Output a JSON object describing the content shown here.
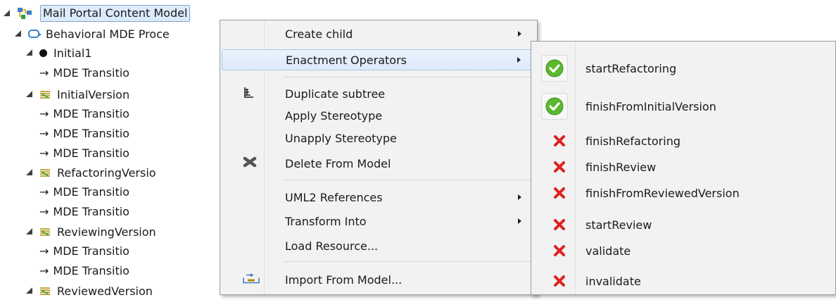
{
  "tree": {
    "root": "Mail Portal Content Model",
    "process": "Behavioral MDE Proce",
    "nodes": [
      {
        "label": "Initial1"
      },
      {
        "label": "MDE Transitio"
      },
      {
        "label": "InitialVersion"
      },
      {
        "label": "MDE Transitio"
      },
      {
        "label": "MDE Transitio"
      },
      {
        "label": "MDE Transitio"
      },
      {
        "label": "RefactoringVersio"
      },
      {
        "label": "MDE Transitio"
      },
      {
        "label": "MDE Transitio"
      },
      {
        "label": "ReviewingVersion"
      },
      {
        "label": "MDE Transitio"
      },
      {
        "label": "MDE Transitio"
      },
      {
        "label": "ReviewedVersion"
      }
    ]
  },
  "menu": {
    "items": [
      {
        "label": "Create child",
        "submenu": true
      },
      {
        "label": "Enactment Operators",
        "submenu": true,
        "highlighted": true
      },
      {
        "label": "Duplicate subtree",
        "icon": "duplicate-icon"
      },
      {
        "label": "Apply Stereotype"
      },
      {
        "label": "Unapply Stereotype"
      },
      {
        "label": "Delete From Model",
        "icon": "delete-icon"
      },
      {
        "label": "UML2 References",
        "submenu": true
      },
      {
        "label": "Transform Into",
        "submenu": true
      },
      {
        "label": "Load Resource..."
      },
      {
        "label": "Import From Model...",
        "icon": "import-icon"
      }
    ]
  },
  "submenu": {
    "items": [
      {
        "label": "startRefactoring",
        "status": "enabled"
      },
      {
        "label": "finishFromInitialVersion",
        "status": "enabled"
      },
      {
        "label": "finishRefactoring",
        "status": "disabled"
      },
      {
        "label": "finishReview",
        "status": "disabled"
      },
      {
        "label": "finishFromReviewedVersion",
        "status": "disabled"
      },
      {
        "label": "startReview",
        "status": "disabled"
      },
      {
        "label": "validate",
        "status": "disabled"
      },
      {
        "label": "invalidate",
        "status": "disabled"
      }
    ]
  },
  "colors": {
    "selection": "#dcebfc",
    "menu_bg": "#f2f2f2",
    "check": "#5cb82e",
    "cross": "#e02020"
  }
}
